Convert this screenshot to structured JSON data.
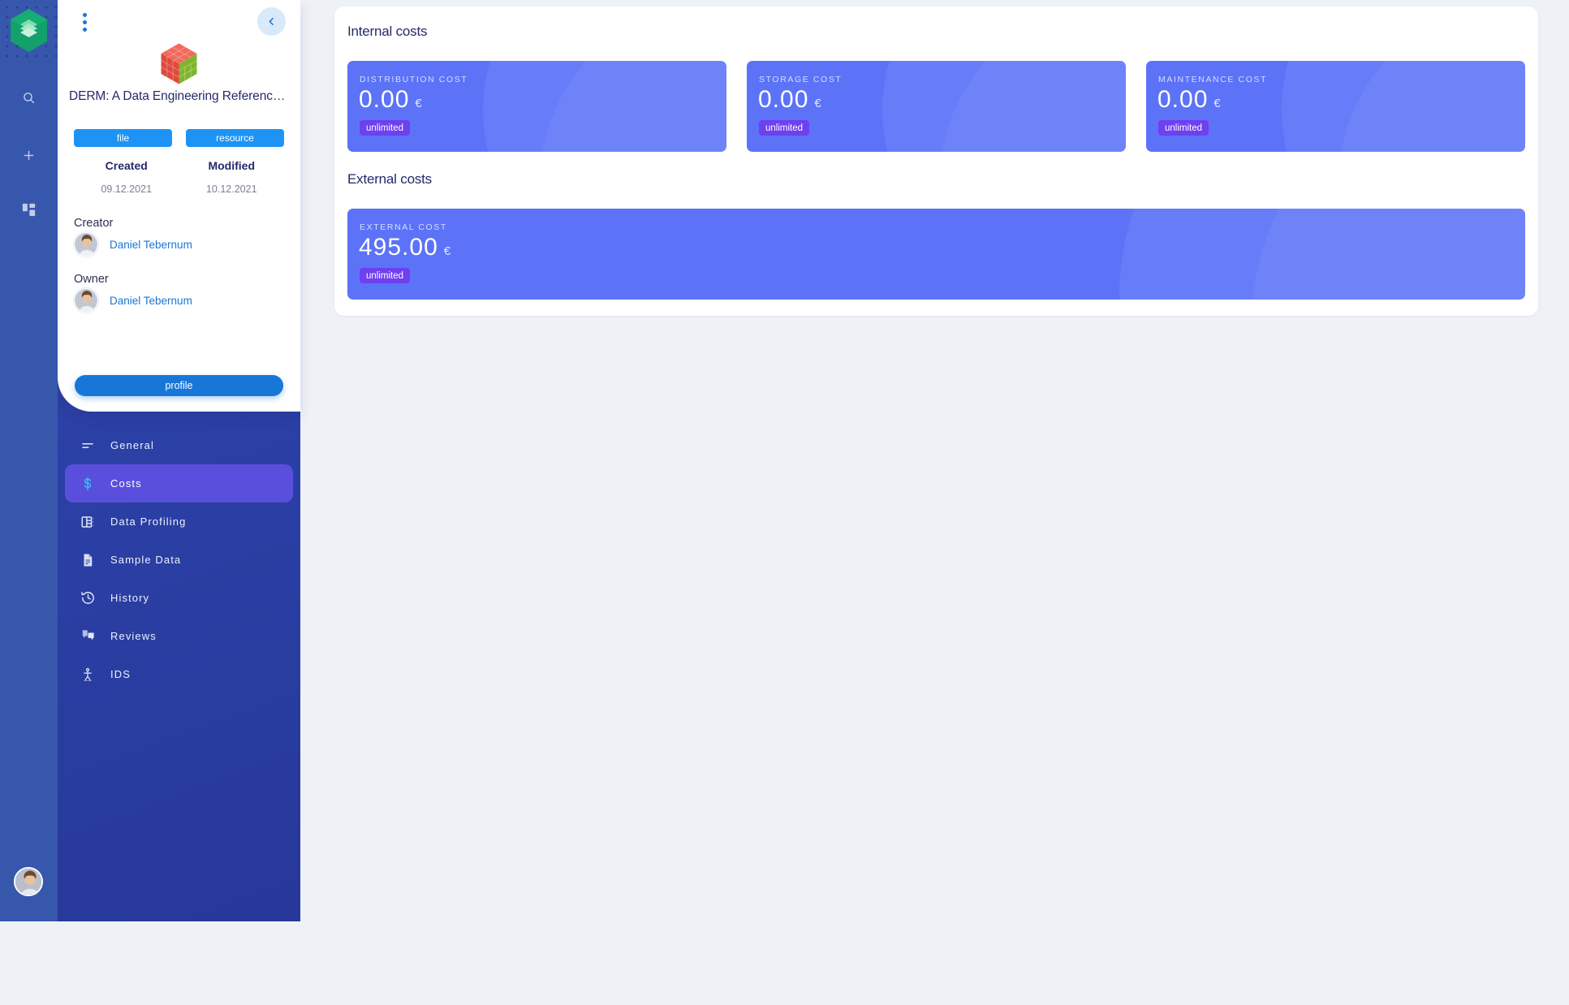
{
  "theme": {
    "rail_bg": "#3757ad",
    "sidebar_bg": "#2a3fa6",
    "page_bg": "#eef1f6",
    "card_bg": "#5c73f8",
    "badge_bg": "#6f3ff0",
    "accent_blue": "#1876d8",
    "active_nav_bg": "#5a4fdd",
    "active_nav_icon": "#2ec5ef",
    "heading_color": "#25296b"
  },
  "rail": {
    "logo_icon": "stacked-layers-hexagon-logo",
    "items": [
      {
        "icon": "search-icon",
        "name": "search"
      },
      {
        "icon": "plus-icon",
        "name": "add"
      },
      {
        "icon": "grid-dashboard-icon",
        "name": "dashboard"
      }
    ],
    "avatar_icon": "user-avatar"
  },
  "detail": {
    "kebab_icon": "more-vertical-icon",
    "collapse_icon": "chevron-left-icon",
    "thumbnail_icon": "isometric-cube-logo",
    "title": "DERM: A Data Engineering Reference Mo...",
    "tags": [
      {
        "label": "file"
      },
      {
        "label": "resource"
      }
    ],
    "meta": [
      {
        "label": "Created",
        "value": "09.12.2021"
      },
      {
        "label": "Modified",
        "value": "10.12.2021"
      }
    ],
    "creator": {
      "label": "Creator",
      "name": "Daniel Tebernum",
      "avatar_icon": "user-avatar"
    },
    "owner": {
      "label": "Owner",
      "name": "Daniel Tebernum",
      "avatar_icon": "user-avatar"
    },
    "profile_button": "profile"
  },
  "nav": {
    "items": [
      {
        "label": "General",
        "icon": "lines-menu-icon",
        "active": false
      },
      {
        "label": "Costs",
        "icon": "dollar-sign-icon",
        "active": true
      },
      {
        "label": "Data Profiling",
        "icon": "table-chart-icon",
        "active": false
      },
      {
        "label": "Sample Data",
        "icon": "document-icon",
        "active": false
      },
      {
        "label": "History",
        "icon": "clock-history-icon",
        "active": false
      },
      {
        "label": "Reviews",
        "icon": "chat-bubbles-icon",
        "active": false
      },
      {
        "label": "IDS",
        "icon": "person-figure-icon",
        "active": false
      }
    ]
  },
  "main": {
    "internal": {
      "title": "Internal costs",
      "cards": [
        {
          "label": "DISTRIBUTION COST",
          "amount": "0.00",
          "currency": "€",
          "badge": "unlimited"
        },
        {
          "label": "STORAGE COST",
          "amount": "0.00",
          "currency": "€",
          "badge": "unlimited"
        },
        {
          "label": "MAINTENANCE COST",
          "amount": "0.00",
          "currency": "€",
          "badge": "unlimited"
        }
      ]
    },
    "external": {
      "title": "External costs",
      "cards": [
        {
          "label": "EXTERNAL COST",
          "amount": "495.00",
          "currency": "€",
          "badge": "unlimited"
        }
      ]
    }
  }
}
